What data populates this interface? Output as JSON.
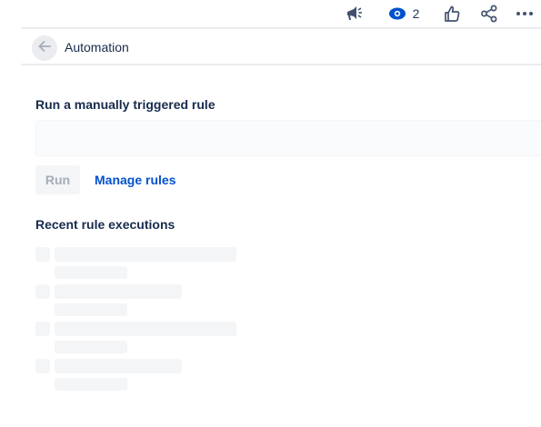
{
  "toolbar": {
    "icons": [
      "megaphone-icon",
      "eye-icon",
      "thumbs-up-icon",
      "share-icon",
      "more-icon"
    ],
    "watch_count": "2"
  },
  "header": {
    "back_icon": "arrow-left-icon",
    "title": "Automation"
  },
  "manual_rule": {
    "section_title": "Run a manually triggered rule",
    "select_value": "",
    "run_label": "Run",
    "manage_link": "Manage rules"
  },
  "recent": {
    "section_title": "Recent rule executions",
    "skeleton_rows": 4
  },
  "colors": {
    "link": "#0052cc",
    "text": "#172b4d",
    "icon": "#42526e",
    "skeleton": "#f4f5f7",
    "disabled_text": "#a5adba"
  }
}
